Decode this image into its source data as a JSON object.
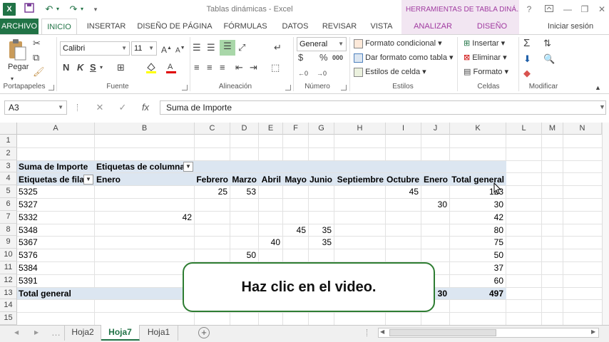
{
  "window": {
    "app_logo": "X",
    "doc_title": "Tablas dinámicas - Excel",
    "tools_title": "HERRAMIENTAS DE TABLA DINÁ...",
    "help": "?",
    "minimize": "—",
    "restore": "❐",
    "close": "✕"
  },
  "qat": {
    "save": "💾",
    "undo": "↶",
    "redo": "↷",
    "more": "▾"
  },
  "tabs": {
    "archivo": "ARCHIVO",
    "inicio": "INICIO",
    "insertar": "INSERTAR",
    "diseno_pagina": "DISEÑO DE PÁGINA",
    "formulas": "FÓRMULAS",
    "datos": "DATOS",
    "revisar": "REVISAR",
    "vista": "VISTA",
    "analizar": "ANALIZAR",
    "diseno": "DISEÑO",
    "signin": "Iniciar sesión"
  },
  "ribbon": {
    "portapapeles": {
      "label": "Portapapeles",
      "pegar": "Pegar"
    },
    "fuente": {
      "label": "Fuente",
      "font": "Calibri",
      "size": "11",
      "grow": "A",
      "shrink": "A",
      "bold": "N",
      "italic": "K",
      "underline": "S"
    },
    "alineacion": {
      "label": "Alineación"
    },
    "numero": {
      "label": "Número",
      "format": "General",
      "currency": "$",
      "percent": "%",
      "thousands": "000"
    },
    "estilos": {
      "label": "Estilos",
      "cond": "Formato condicional",
      "table": "Dar formato como tabla",
      "cell": "Estilos de celda"
    },
    "celdas": {
      "label": "Celdas",
      "insert": "Insertar",
      "delete": "Eliminar",
      "format": "Formato"
    },
    "modificar": {
      "label": "Modificar",
      "sum": "Σ"
    }
  },
  "formula_bar": {
    "name_box": "A3",
    "cancel": "✕",
    "enter": "✓",
    "fx": "fx",
    "value": "Suma de Importe"
  },
  "columns": [
    "A",
    "B",
    "C",
    "D",
    "E",
    "F",
    "G",
    "H",
    "I",
    "J",
    "K",
    "L",
    "M",
    "N"
  ],
  "rows": [
    "1",
    "2",
    "3",
    "4",
    "5",
    "6",
    "7",
    "8",
    "9",
    "10",
    "11",
    "12",
    "13",
    "14",
    "15"
  ],
  "pivot": {
    "title": "Suma de Importe",
    "col_labels": "Etiquetas de columna",
    "row_labels": "Etiquetas de fila",
    "headers": [
      "Enero",
      "Febrero",
      "Marzo",
      "Abril",
      "Mayo",
      "Junio",
      "Septiembre",
      "Octubre",
      "Enero",
      "Total general"
    ],
    "rows": [
      {
        "label": "5325",
        "cells": [
          "",
          "25",
          "53",
          "",
          "",
          "",
          "",
          "45",
          "",
          "123"
        ]
      },
      {
        "label": "5327",
        "cells": [
          "",
          "",
          "",
          "",
          "",
          "",
          "",
          "",
          "30",
          "30"
        ]
      },
      {
        "label": "5332",
        "cells": [
          "42",
          "",
          "",
          "",
          "",
          "",
          "",
          "",
          "",
          "42"
        ]
      },
      {
        "label": "5348",
        "cells": [
          "",
          "",
          "",
          "",
          "45",
          "35",
          "",
          "",
          "",
          "80"
        ]
      },
      {
        "label": "5367",
        "cells": [
          "",
          "",
          "",
          "40",
          "",
          "35",
          "",
          "",
          "",
          "75"
        ]
      },
      {
        "label": "5376",
        "cells": [
          "",
          "",
          "50",
          "",
          "",
          "",
          "",
          "",
          "",
          "50"
        ]
      },
      {
        "label": "5384",
        "cells": [
          "",
          "",
          "",
          "",
          "",
          "",
          "",
          "",
          "",
          "37"
        ]
      },
      {
        "label": "5391",
        "cells": [
          "",
          "",
          "",
          "",
          "",
          "",
          "",
          "",
          "",
          "60"
        ]
      }
    ],
    "total_label": "Total general",
    "total_cells": [
      "",
      "",
      "",
      "",
      "",
      "",
      "",
      "",
      "30",
      "497"
    ]
  },
  "overlay": {
    "text": "Haz clic en el video."
  },
  "sheets": {
    "hoja2": "Hoja2",
    "hoja7": "Hoja7",
    "hoja1": "Hoja1",
    "add": "+"
  },
  "colors": {
    "excel_green": "#217346",
    "tools_purple": "#a03aa0",
    "pivot_band": "#dce6f1"
  }
}
